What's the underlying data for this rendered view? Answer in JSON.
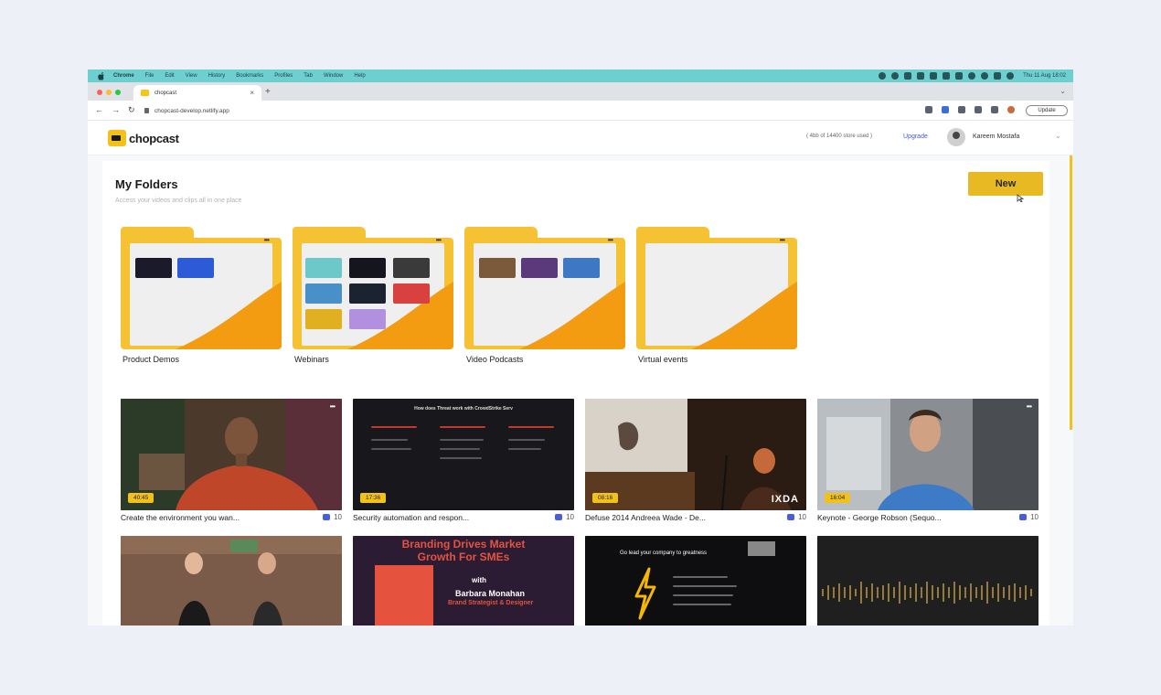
{
  "menubar": {
    "app": "Chrome",
    "items": [
      "File",
      "Edit",
      "View",
      "History",
      "Bookmarks",
      "Profiles",
      "Tab",
      "Window",
      "Help"
    ],
    "clock": "Thu 11 Aug 18:02"
  },
  "browser": {
    "tab_title": "chopcast",
    "url": "chopcast-develop.netlify.app",
    "update_label": "Update"
  },
  "header": {
    "brand": "chopcast",
    "storage": "( 4bb of 14400 store used )",
    "upgrade": "Upgrade",
    "user_name": "Kareem Mostafa"
  },
  "page": {
    "title": "My Folders",
    "subtitle": "Access your videos and clips all in one place",
    "new_button": "New"
  },
  "folders": [
    {
      "name": "Product Demos"
    },
    {
      "name": "Webinars"
    },
    {
      "name": "Video Podcasts"
    },
    {
      "name": "Virtual events"
    }
  ],
  "videos": [
    {
      "title": "Create the environment you wan...",
      "duration": "40:45",
      "views": "10"
    },
    {
      "title": "Security automation and respon...",
      "duration": "17:36",
      "views": "10"
    },
    {
      "title": "Defuse 2014 Andreea Wade - De...",
      "duration": "08:16",
      "views": "10"
    },
    {
      "title": "Keynote - George Robson (Sequo...",
      "duration": "16:04",
      "views": "10"
    },
    {
      "title": "",
      "duration": "",
      "views": ""
    },
    {
      "title": "",
      "duration": "",
      "views": ""
    },
    {
      "title": "",
      "duration": "",
      "views": ""
    },
    {
      "title": "",
      "duration": "",
      "views": ""
    }
  ],
  "thumb_text": {
    "security_heading": "How does Threat work with CrowdStrike Serv",
    "branding_line1": "Branding Drives Market",
    "branding_line2": "Growth For SMEs",
    "branding_with": "with",
    "branding_name": "Barbara Monahan",
    "branding_role": "Brand Strategist & Designer",
    "greatness": "Go lead your company to greatness",
    "ixda": "IXDA"
  },
  "colors": {
    "accent": "#f2c21b",
    "menubar": "#6ecfd0",
    "link": "#3b5bd8"
  }
}
